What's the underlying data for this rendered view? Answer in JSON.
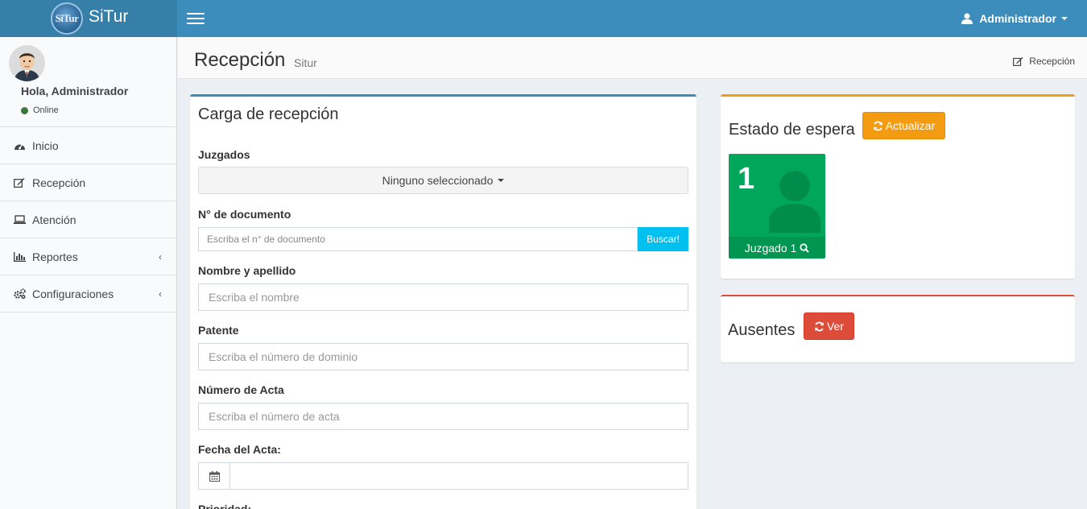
{
  "brand": {
    "name": "SiTur",
    "emblem_text": "SiTur"
  },
  "navbar": {
    "user_label": "Administrador"
  },
  "sidebar": {
    "greeting": "Hola, Administrador",
    "status": "Online",
    "items": [
      {
        "label": "Inicio",
        "icon": "dashboard-icon"
      },
      {
        "label": "Recepción",
        "icon": "edit-icon"
      },
      {
        "label": "Atención",
        "icon": "laptop-icon"
      },
      {
        "label": "Reportes",
        "icon": "bar-chart-icon",
        "chevron": "‹"
      },
      {
        "label": "Configuraciones",
        "icon": "gears-icon",
        "chevron": "‹"
      }
    ]
  },
  "header": {
    "title": "Recepción",
    "subtitle": "Situr",
    "breadcrumb": "Recepción"
  },
  "form": {
    "title": "Carga de recepción",
    "juzgados_label": "Juzgados",
    "juzgados_value": "Ninguno seleccionado",
    "documento_label": "N° de documento",
    "documento_placeholder": "Escriba el n° de documento",
    "buscar_label": "Buscar!",
    "nombre_label": "Nombre y apellido",
    "nombre_placeholder": "Escriba el nombre",
    "patente_label": "Patente",
    "patente_placeholder": "Escriba el número de dominio",
    "acta_label": "Número de Acta",
    "acta_placeholder": "Escriba el número de acta",
    "fecha_label": "Fecha del Acta:",
    "prioridad_label": "Prioridad:"
  },
  "wait": {
    "title": "Estado de espera",
    "refresh_label": "Actualizar",
    "count": "1",
    "footer": "Juzgado 1"
  },
  "absent": {
    "title": "Ausentes",
    "view_label": "Ver"
  },
  "colors": {
    "primary": "#3c8dbc",
    "warning": "#f39c12",
    "success": "#00a65a",
    "danger": "#dd4b39",
    "info": "#00c0ef"
  }
}
